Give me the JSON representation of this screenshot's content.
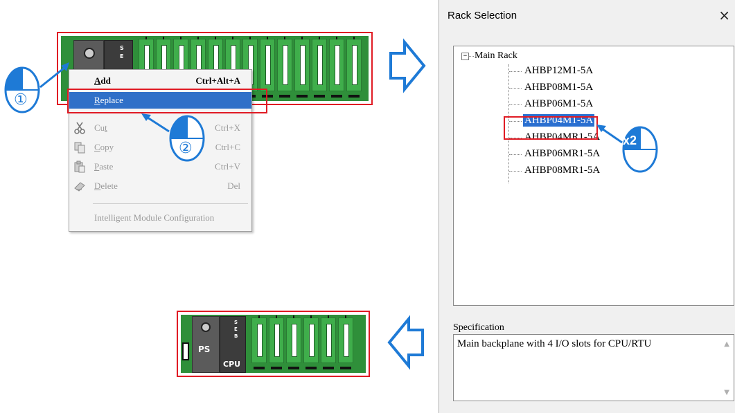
{
  "context_menu": {
    "items": [
      {
        "label": "Add",
        "accel": "A",
        "shortcut": "Ctrl+Alt+A",
        "enabled": true
      },
      {
        "label": "Replace",
        "accel": "R",
        "shortcut": "",
        "enabled": true,
        "selected": true
      },
      {
        "label": "Cut",
        "accel": "t",
        "shortcut": "Ctrl+X",
        "enabled": false
      },
      {
        "label": "Copy",
        "accel": "C",
        "shortcut": "Ctrl+C",
        "enabled": false
      },
      {
        "label": "Paste",
        "accel": "P",
        "shortcut": "Ctrl+V",
        "enabled": false
      },
      {
        "label": "Delete",
        "accel": "D",
        "shortcut": "Del",
        "enabled": false
      },
      {
        "label": "Intelligent Module Configuration",
        "shortcut": "",
        "enabled": false
      }
    ]
  },
  "callouts": {
    "step1": "①",
    "step2": "②",
    "double_click": "x2"
  },
  "dialog": {
    "title": "Rack Selection",
    "close_glyph": "×",
    "tree": {
      "root": "Main Rack",
      "toggle": "−",
      "items": [
        "AHBP12M1-5A",
        "AHBP08M1-5A",
        "AHBP06M1-5A",
        "AHBP04M1-5A",
        "AHBP04MR1-5A",
        "AHBP06MR1-5A",
        "AHBP08MR1-5A"
      ],
      "selected_index": 3
    },
    "specification_label": "Specification",
    "specification_text": "Main backplane with 4 I/O slots for CPU/RTU"
  },
  "result_rack": {
    "ps_label": "PS",
    "cpu_label": "CPU",
    "cpu_leds": [
      "S",
      "E",
      "B"
    ]
  },
  "source_rack": {
    "cpu_leds": [
      "S",
      "E"
    ]
  },
  "colors": {
    "highlight_red": "#e01b24",
    "arrow_blue": "#1e7ad6",
    "menu_select": "#3070c8",
    "rack_green": "#3fae4b"
  },
  "icons": [
    "cut-icon",
    "copy-icon",
    "paste-icon",
    "delete-icon",
    "mouse-icon",
    "flow-arrow-right-icon",
    "flow-arrow-left-icon"
  ]
}
